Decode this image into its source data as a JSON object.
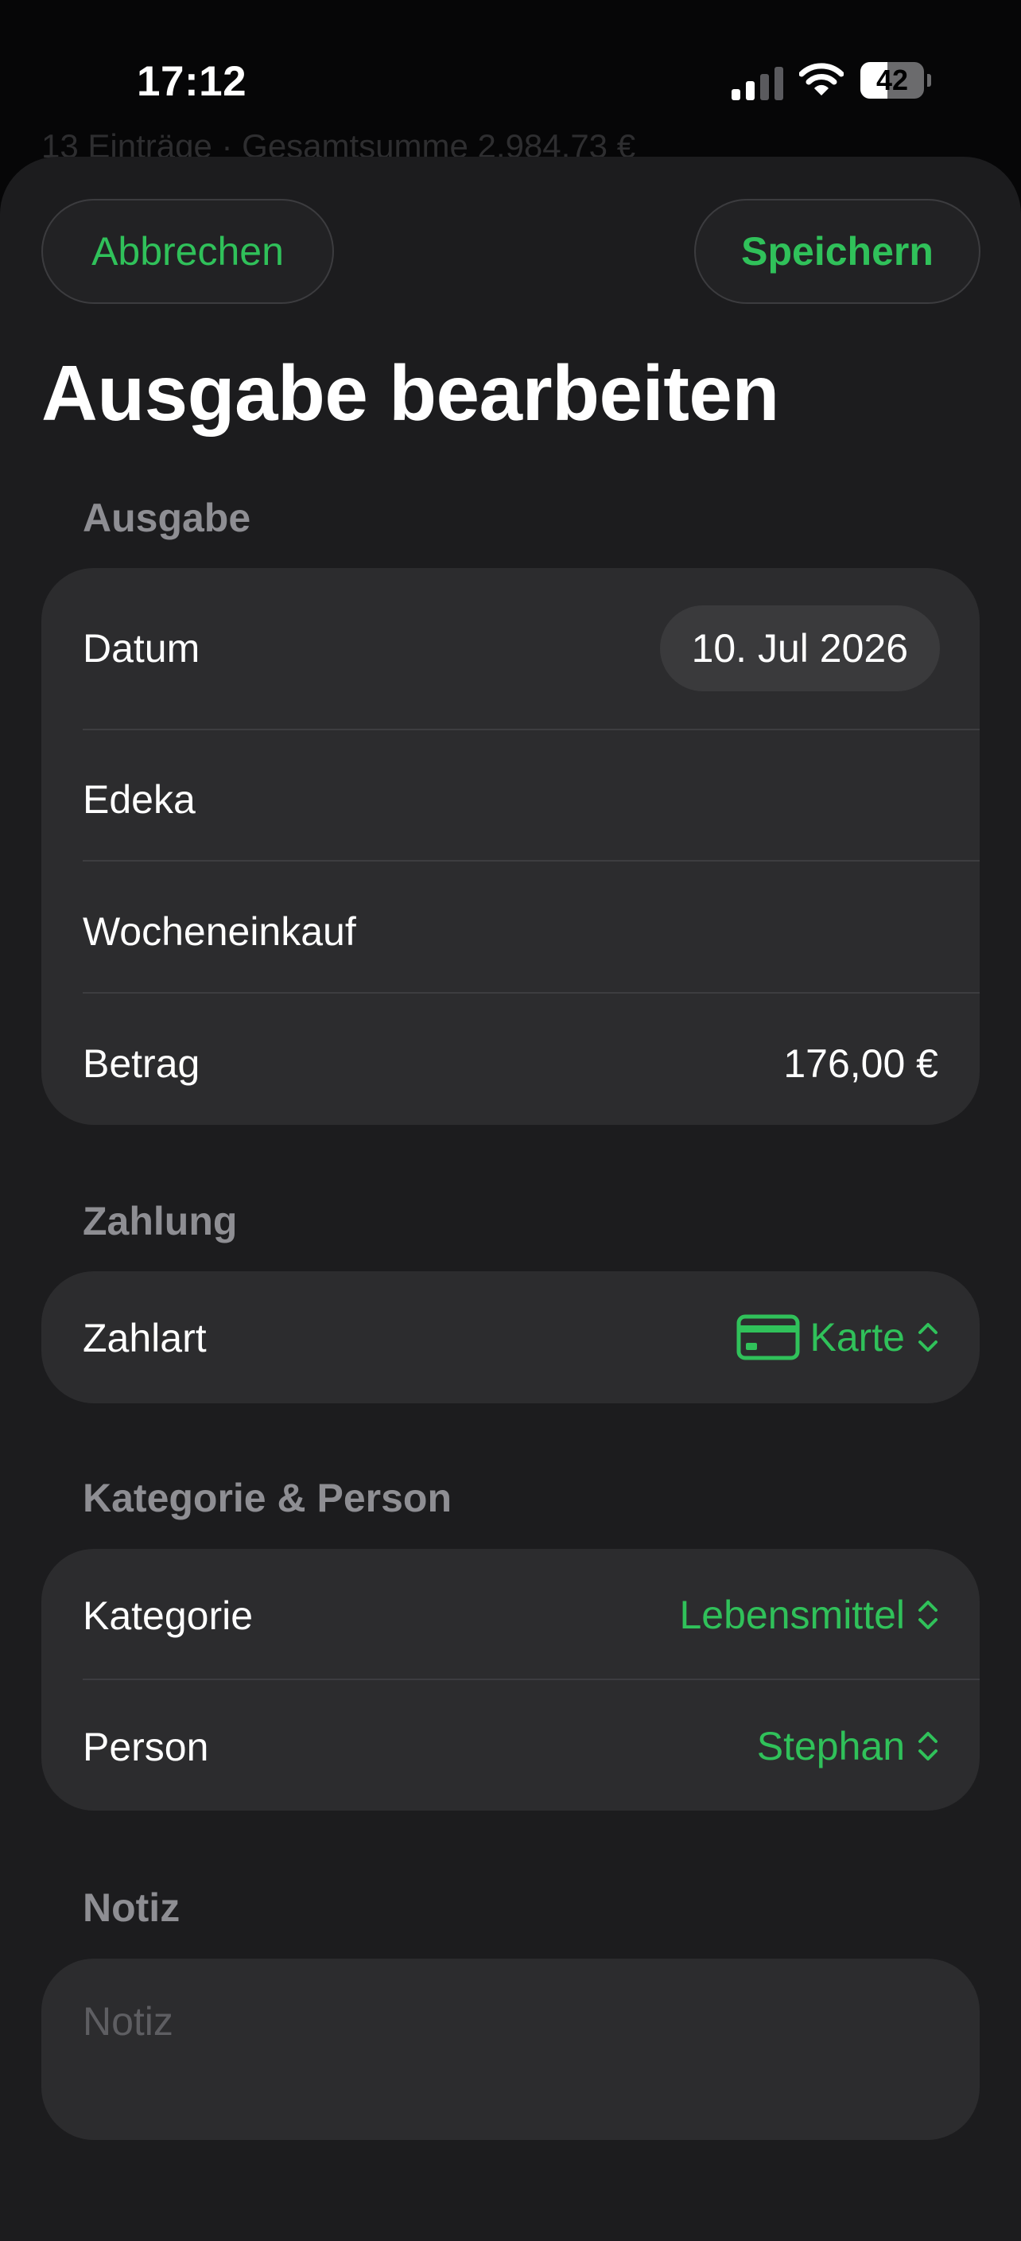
{
  "status_bar": {
    "time": "17:12",
    "battery_level": "42",
    "battery_fill_fraction": 0.42,
    "signal_bars_active": 2,
    "signal_bars_total": 4
  },
  "background_list": {
    "summary": "13 Einträge · Gesamtsumme 2.984,73 €"
  },
  "nav": {
    "cancel_label": "Abbrechen",
    "save_label": "Speichern"
  },
  "title": "Ausgabe bearbeiten",
  "sections": {
    "expense": {
      "header": "Ausgabe",
      "date_label": "Datum",
      "date_value": "10. Jul 2026",
      "merchant": "Edeka",
      "description": "Wocheneinkauf",
      "amount_label": "Betrag",
      "amount_value": "176,00 €"
    },
    "payment": {
      "header": "Zahlung",
      "method_label": "Zahlart",
      "method_value": "Karte",
      "method_icon": "creditcard-icon"
    },
    "category_person": {
      "header": "Kategorie & Person",
      "category_label": "Kategorie",
      "category_value": "Lebensmittel",
      "person_label": "Person",
      "person_value": "Stephan"
    },
    "note": {
      "header": "Notiz",
      "placeholder": "Notiz"
    }
  },
  "colors": {
    "accent": "#30c15a",
    "sheet_background": "#1c1c1e",
    "card_background": "#2c2c2e",
    "secondary_text": "#8e8e93"
  }
}
